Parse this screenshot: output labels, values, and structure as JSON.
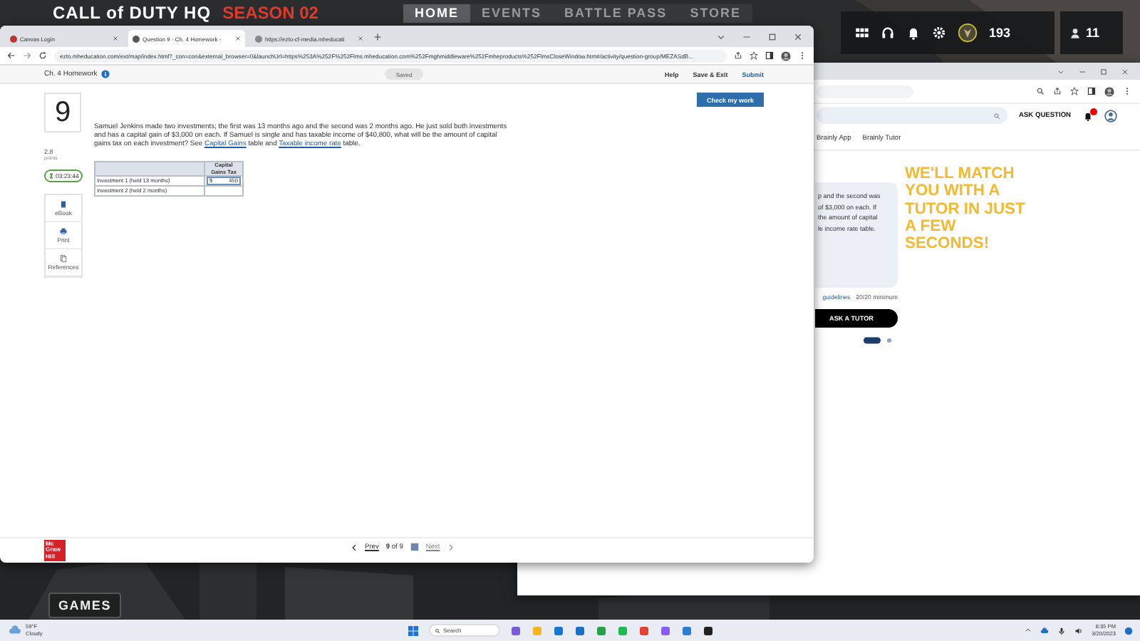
{
  "game": {
    "logo": "CALL of DUTY HQ",
    "season": "SEASON 02",
    "nav": [
      {
        "label": "HOME",
        "selected": true
      },
      {
        "label": "EVENTS",
        "selected": false
      },
      {
        "label": "BATTLE PASS",
        "selected": false
      },
      {
        "label": "STORE",
        "selected": false
      }
    ],
    "points": "193",
    "friends": "11",
    "games_button": "GAMES"
  },
  "back_window": {
    "ask_question": "ASK QUESTION",
    "nav": [
      "Brainly App",
      "Brainly Tutor"
    ],
    "question_lines": [
      "p and the second was",
      "of $3,000 on each. If",
      "the amount of capital",
      "le income rate table."
    ],
    "guidelines_link": "guidelines",
    "minimum": "20/20 minimum",
    "ask_tutor": "ASK A TUTOR",
    "promo_lines": [
      "WE'LL MATCH",
      "YOU WITH A",
      "TUTOR IN JUST",
      "A FEW",
      "SECONDS!"
    ]
  },
  "front_window": {
    "tabs": [
      {
        "title": "Canvas Login",
        "selected": false
      },
      {
        "title": "Question 9 - Ch. 4 Homework -",
        "selected": true
      },
      {
        "title": "https://ezto-cf-media.mheducati",
        "selected": false
      }
    ],
    "url": "ezto.mheducation.com/ext/map/index.html?_con=con&external_browser=0&launchUrl=https%253A%252F%252Flms.mheducation.com%252Fmghmiddleware%252Fmheproducts%252FlmsCloseWindow.htm#/activity/question-group/MEZASdB...",
    "assignment": "Ch. 4 Homework",
    "save_status": "Saved",
    "header_links": [
      "Help",
      "Save & Exit",
      "Submit"
    ],
    "check_button": "Check my work",
    "question_number": "9",
    "points": "2.8",
    "points_label": "points",
    "timer": "03:23:44",
    "tools": [
      {
        "kind": "book",
        "label": "eBook"
      },
      {
        "kind": "print",
        "label": "Print"
      },
      {
        "kind": "references",
        "label": "References"
      }
    ],
    "question": {
      "before": "Samuel Jenkins made two investments; the first was 13 months ago and the second was 2 months ago. He just sold both investments and has a capital gain of $3,000 on each. If Samuel is single and has taxable income of $40,800, what will be the amount of capital gains tax on each investment? See ",
      "link_1": "Capital Gains",
      "middle": " table and ",
      "link_2": "Taxable income rate",
      "after": " table."
    },
    "table": {
      "column_header": "Capital Gains Tax",
      "rows": [
        {
          "label": "Investment 1 (held 13 months)",
          "currency": "$",
          "value": "450"
        },
        {
          "label": "Investment 2 (held 2 months)"
        }
      ]
    },
    "footer": {
      "logo": "Mc Graw Hill",
      "prev": "Prev",
      "page": "9",
      "of": "of 9",
      "next": "Next"
    }
  },
  "taskbar": {
    "temperature": "59°F",
    "weather": "Cloudy",
    "search_placeholder": "Search",
    "time": "8:35 PM",
    "date": "3/20/2023"
  }
}
